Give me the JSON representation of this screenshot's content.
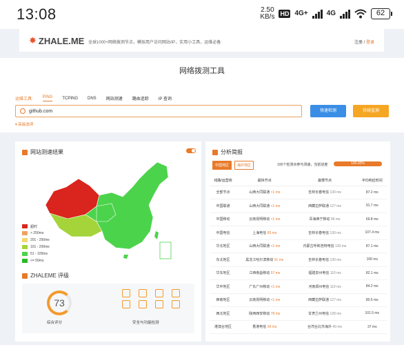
{
  "status_bar": {
    "time": "13:08",
    "speed_value": "2.50",
    "speed_unit": "KB/s",
    "hd_badge": "HD",
    "network_1": "4G+",
    "network_2": "4G",
    "battery": "62"
  },
  "nav": {
    "logo": "ZHALE.ME",
    "tagline": "全球1000+网络拨测节点，模拟用户访问网站/IP，实用小工具，运维必备",
    "register": "注册",
    "separator": " / ",
    "login": "登录"
  },
  "tool": {
    "title": "网络拨测工具",
    "label": "运维工具:",
    "tabs": [
      "PING",
      "TCPING",
      "DNS",
      "网站测速",
      "路由追踪",
      "IP 查询"
    ],
    "active_tab": "PING",
    "search_value": "github.com",
    "btn_quick": "快速检测",
    "btn_full": "持续监测",
    "advanced": "高级选项"
  },
  "speed_card": {
    "title": "网站测速结果",
    "legend": [
      {
        "label": "超时",
        "color": "#d9251d"
      },
      {
        "label": "> 250ms",
        "color": "#f0a35e"
      },
      {
        "label": "201 - 250ms",
        "color": "#f5d76e"
      },
      {
        "label": "101 - 200ms",
        "color": "#a4d43a"
      },
      {
        "label": "51 - 100ms",
        "color": "#4cd34c"
      },
      {
        "label": "<= 50ms",
        "color": "#2ab82a"
      }
    ]
  },
  "score_card": {
    "title": "ZHALEME 评级",
    "score": "73",
    "score_label": "综合评分",
    "security_label": "安全与功能检测"
  },
  "analysis": {
    "title": "分析简报",
    "badge_cn": "中国地区",
    "badge_overseas": "海外地区",
    "progress_text": "100个检测点参与测速，当前进度",
    "progress_value": "100.00%",
    "progress_fraction": 1.0,
    "columns": [
      "线路/运营商",
      "最快节点",
      "最慢节点",
      "平均响应时间"
    ],
    "rows": [
      {
        "line": "全部节点",
        "fast": "山西大同联通",
        "fast_ms": "<1 ms",
        "slow": "吉林长春电信",
        "slow_ms": "130 ms",
        "avg": "87.2 ms"
      },
      {
        "line": "中国联通",
        "fast": "山西大同联通",
        "fast_ms": "<1 ms",
        "slow": "西藏拉萨联通",
        "slow_ms": "127 ms",
        "avg": "91.7 ms"
      },
      {
        "line": "中国移动",
        "fast": "云南昆明移动",
        "fast_ms": "<1 ms",
        "slow": "青海西宁移动",
        "slow_ms": "96 ms",
        "avg": "69.8 ms"
      },
      {
        "line": "中国电信",
        "fast": "上海电信",
        "fast_ms": "83 ms",
        "slow": "吉林长春电信",
        "slow_ms": "130 ms",
        "avg": "107.4 ms"
      },
      {
        "line": "华北地区",
        "fast": "山西大同联通",
        "fast_ms": "<1 ms",
        "slow": "内蒙古呼和浩特电信",
        "slow_ms": "130 ms",
        "avg": "87.1 ms"
      },
      {
        "line": "东北地区",
        "fast": "黑龙江哈尔滨移动",
        "fast_ms": "91 ms",
        "slow": "吉林长春电信",
        "slow_ms": "130 ms",
        "avg": "106 ms"
      },
      {
        "line": "华东地区",
        "fast": "江西南昌移动",
        "fast_ms": "57 ms",
        "slow": "福建泉州电信",
        "slow_ms": "110 ms",
        "avg": "82.1 ms"
      },
      {
        "line": "华中地区",
        "fast": "广东广州移动",
        "fast_ms": "<1 ms",
        "slow": "河南郑州电信",
        "slow_ms": "119 ms",
        "avg": "84.2 ms"
      },
      {
        "line": "西南地区",
        "fast": "云南昆明移动",
        "fast_ms": "<1 ms",
        "slow": "西藏拉萨联通",
        "slow_ms": "127 ms",
        "avg": "80.5 ms"
      },
      {
        "line": "西北地区",
        "fast": "陕西西安移动",
        "fast_ms": "78 ms",
        "slow": "甘肃兰州电信",
        "slow_ms": "128 ms",
        "avg": "101.5 ms"
      },
      {
        "line": "港澳台地区",
        "fast": "香港电信",
        "fast_ms": "34 ms",
        "slow": "台湾台北市海外",
        "slow_ms": "40 ms",
        "avg": "37 ms"
      }
    ]
  }
}
